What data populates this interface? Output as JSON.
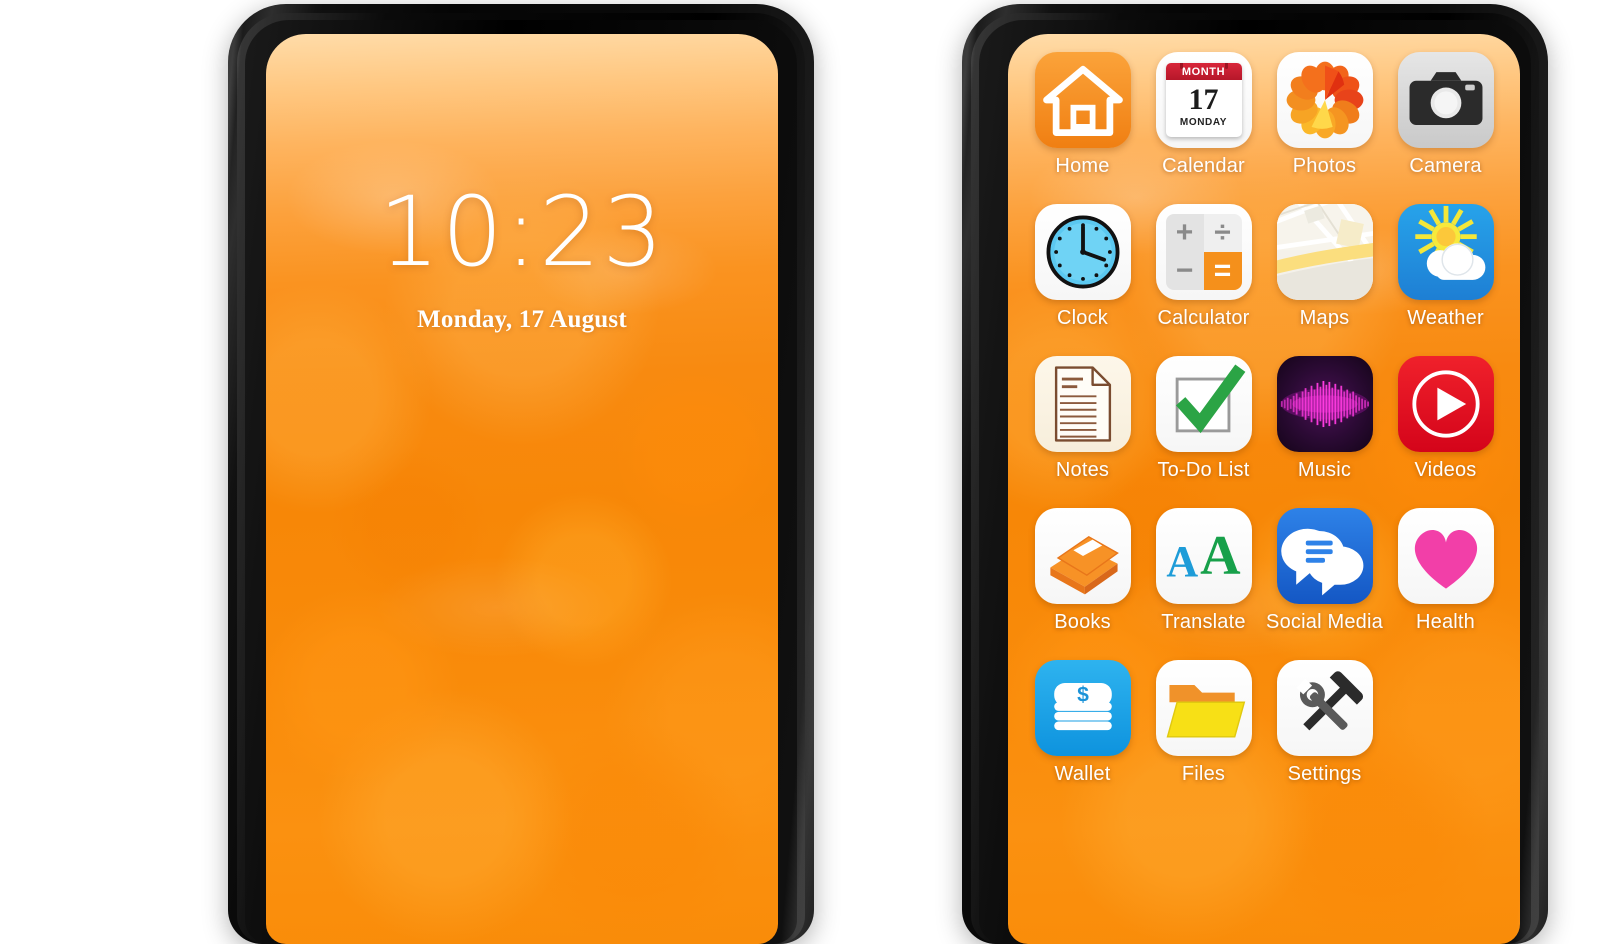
{
  "scene": {
    "background_color": "#ffffff",
    "wallpaper_color": "#F98B0A",
    "bezel_color": "#0b0b0b"
  },
  "lock_phone": {
    "name": "Lock screen phone",
    "time": "10:23",
    "date": "Monday, 17 August"
  },
  "home_phone": {
    "name": "Home screen phone",
    "apps": [
      {
        "label": "Home",
        "icon": "house-icon",
        "tile": "bg-home"
      },
      {
        "label": "Calendar",
        "icon": "calendar-icon",
        "tile": "bg-white",
        "calendar": {
          "month": "MONTH",
          "day": "17",
          "weekday": "MONDAY",
          "header_color": "#C81E32"
        }
      },
      {
        "label": "Photos",
        "icon": "flower-icon",
        "tile": "bg-white"
      },
      {
        "label": "Camera",
        "icon": "camera-icon",
        "tile": "bg-gray"
      },
      {
        "label": "Clock",
        "icon": "clock-icon",
        "tile": "bg-white"
      },
      {
        "label": "Calculator",
        "icon": "calculator-icon",
        "tile": "bg-white",
        "keys": [
          "+",
          "÷",
          "−",
          "="
        ]
      },
      {
        "label": "Maps",
        "icon": "map-icon",
        "tile": "bg-white"
      },
      {
        "label": "Weather",
        "icon": "sun-cloud-icon",
        "tile": "bg-weather"
      },
      {
        "label": "Notes",
        "icon": "note-page-icon",
        "tile": "bg-cream"
      },
      {
        "label": "To-Do List",
        "icon": "checkbox-icon",
        "tile": "bg-white"
      },
      {
        "label": "Music",
        "icon": "waveform-icon",
        "tile": "bg-music"
      },
      {
        "label": "Videos",
        "icon": "play-icon",
        "tile": "bg-video"
      },
      {
        "label": "Books",
        "icon": "book-icon",
        "tile": "bg-white"
      },
      {
        "label": "Translate",
        "icon": "letters-aa-icon",
        "tile": "bg-white",
        "letters": [
          "A",
          "A"
        ]
      },
      {
        "label": "Social Media",
        "icon": "chat-bubbles-icon",
        "tile": "bg-social"
      },
      {
        "label": "Health",
        "icon": "heart-icon",
        "tile": "bg-white"
      },
      {
        "label": "Wallet",
        "icon": "money-icon",
        "tile": "bg-wallet"
      },
      {
        "label": "Files",
        "icon": "folder-icon",
        "tile": "bg-white"
      },
      {
        "label": "Settings",
        "icon": "tools-icon",
        "tile": "bg-white"
      }
    ]
  }
}
